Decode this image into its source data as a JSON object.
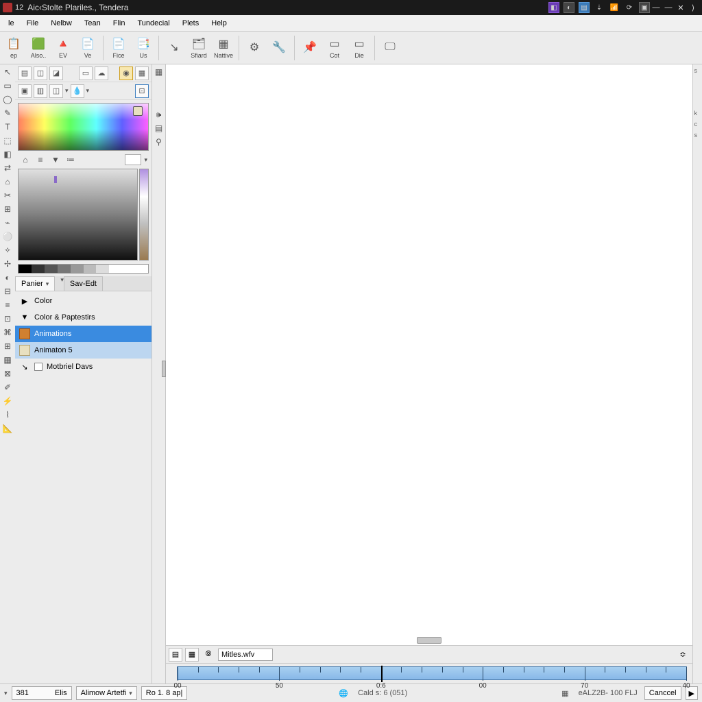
{
  "titlebar": {
    "prefix": "12",
    "title": "Aic‹Stolte Plariles., Tendera"
  },
  "menubar": [
    "le",
    "File",
    "Nelbw",
    "Tean",
    "Flin",
    "Tundecial",
    "Plets",
    "Help"
  ],
  "toolbar": [
    {
      "icon": "📋",
      "label": "ep"
    },
    {
      "icon": "🟩",
      "label": "Also.."
    },
    {
      "icon": "🔺",
      "label": "EV"
    },
    {
      "icon": "📄",
      "label": "Ve"
    },
    {
      "sep": true
    },
    {
      "icon": "📄",
      "label": "Fice"
    },
    {
      "icon": "📑",
      "label": "Us"
    },
    {
      "sep": true
    },
    {
      "icon": "↘",
      "label": ""
    },
    {
      "icon": "🗂",
      "label": "Sfiard"
    },
    {
      "icon": "▦",
      "label": "Nattive"
    },
    {
      "sep": true
    },
    {
      "icon": "⚙",
      "label": ""
    },
    {
      "icon": "🔧",
      "label": ""
    },
    {
      "sep": true
    },
    {
      "icon": "📌",
      "label": ""
    },
    {
      "icon": "▭",
      "label": "Cot"
    },
    {
      "icon": "▭",
      "label": "Die"
    },
    {
      "sep": true
    },
    {
      "icon": "🖵",
      "label": ""
    }
  ],
  "sidepanel": {
    "tab1": {
      "label": "Panier",
      "savelabel": "Sav‑Edt"
    },
    "tree": {
      "color": "Color",
      "colorprops": "Color & Paptestirs",
      "animations": "Animations",
      "animation_item": "Animaton 5",
      "motbriel": "Motbriel Davs"
    }
  },
  "timeline": {
    "tab_label": "Mitles.wfv",
    "ticks": [
      "00",
      "50",
      "0:6",
      "00",
      "70",
      "40"
    ]
  },
  "statusbar": {
    "num": "381",
    "elis": "Elis",
    "combo1": "Alimow Artetfi",
    "combo2": "Ro 1. 8 ap|",
    "center": "Cald s: 6 (051)",
    "right_info": "eALZ2B- 100 FLJ",
    "cancel": "Canccel"
  }
}
